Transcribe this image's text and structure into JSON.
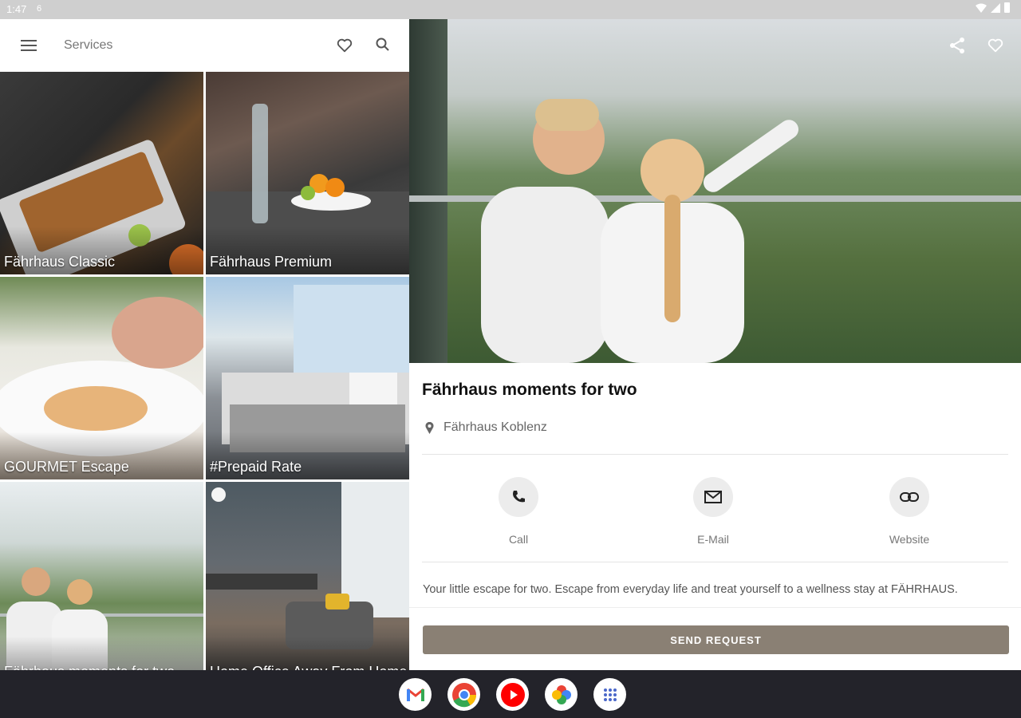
{
  "status_bar": {
    "time": "1:47",
    "notif": "6"
  },
  "toolbar": {
    "title": "Services"
  },
  "tiles": [
    {
      "label": "Fährhaus Classic"
    },
    {
      "label": "Fährhaus Premium"
    },
    {
      "label": "GOURMET Escape"
    },
    {
      "label": "#Prepaid Rate"
    },
    {
      "label": "Fährhaus moments for two"
    },
    {
      "label": "Home Office Away From Home"
    }
  ],
  "detail": {
    "title": "Fährhaus moments for two",
    "location": "Fährhaus Koblenz",
    "actions": {
      "call": "Call",
      "email": "E-Mail",
      "website": "Website"
    },
    "description": "Your little escape for two. Escape from everyday life and treat yourself to a wellness stay at FÄHRHAUS.",
    "send_label": "SEND REQUEST"
  },
  "dock_apps": [
    "gmail-icon",
    "chrome-icon",
    "youtube-icon",
    "photos-icon",
    "app-drawer-icon"
  ],
  "colors": {
    "button": "#8a8074",
    "nav_bar": "#23232a",
    "status_bar": "#cfcfcf"
  }
}
